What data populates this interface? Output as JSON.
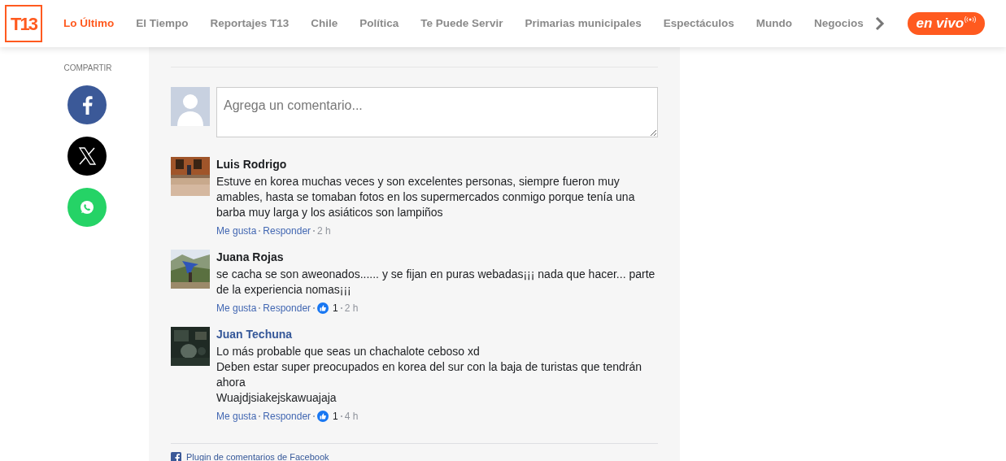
{
  "logo": {
    "text": "T13"
  },
  "nav": [
    {
      "label": "Lo Último",
      "selected": true
    },
    {
      "label": "El Tiempo",
      "selected": false
    },
    {
      "label": "Reportajes T13",
      "selected": false
    },
    {
      "label": "Chile",
      "selected": false
    },
    {
      "label": "Política",
      "selected": false
    },
    {
      "label": "Te Puede Servir",
      "selected": false
    },
    {
      "label": "Primarias municipales",
      "selected": false
    },
    {
      "label": "Espectáculos",
      "selected": false
    },
    {
      "label": "Mundo",
      "selected": false
    },
    {
      "label": "Negocios",
      "selected": false
    }
  ],
  "live_button": {
    "label": "en vivo"
  },
  "share": {
    "label": "COMPARTIR",
    "networks": [
      {
        "kind": "facebook",
        "color": "#3b5998"
      },
      {
        "kind": "x",
        "color": "#000000"
      },
      {
        "kind": "whatsapp",
        "color": "#25d366"
      }
    ]
  },
  "comment_box": {
    "placeholder": "Agrega un comentario..."
  },
  "comments": [
    {
      "author": "Luis Rodrigo",
      "author_is_link": false,
      "text_lines": [
        "Estuve en korea muchas veces y son excelentes personas, siempre fueron muy amables, hasta se tomaban fotos en los supermercados conmigo porque tenía una barba muy larga y los asiáticos son lampiños"
      ],
      "like_label": "Me gusta",
      "reply_label": "Responder",
      "time": "2 h"
    },
    {
      "author": "Juana Rojas",
      "author_is_link": false,
      "text_lines": [
        "se cacha se son aweonados...... y se fijan en puras webadas¡¡¡ nada que hacer... parte de la experiencia nomas¡¡¡"
      ],
      "like_label": "Me gusta",
      "reply_label": "Responder",
      "likes": "1",
      "time": "2 h"
    },
    {
      "author": "Juan Techuna",
      "author_is_link": true,
      "text_lines": [
        "Lo más probable que seas un chachalote ceboso xd",
        "Deben estar super preocupados en korea del sur con la baja de turistas que tendrán ahora",
        "Wuajdjsiakejskawuajaja"
      ],
      "like_label": "Me gusta",
      "reply_label": "Responder",
      "likes": "1",
      "time": "4 h"
    }
  ],
  "plugin_footer": {
    "text": "Plugin de comentarios de Facebook"
  }
}
